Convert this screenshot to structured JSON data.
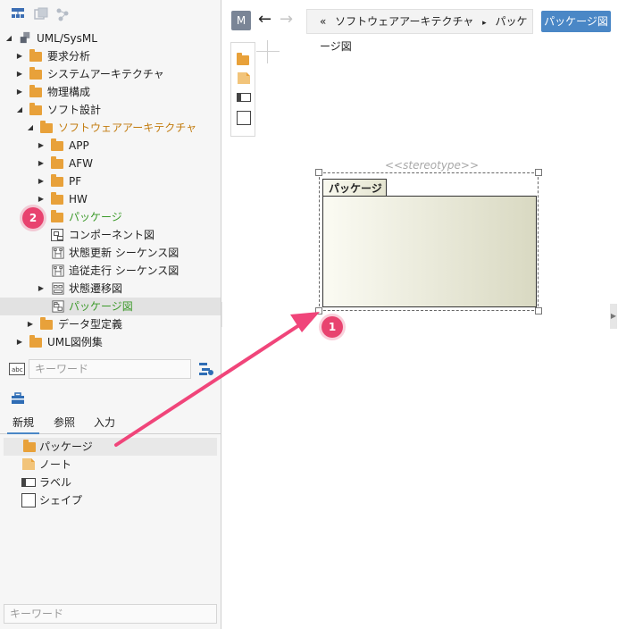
{
  "tree": {
    "items": [
      {
        "label": "UML/SysML"
      },
      {
        "label": "要求分析"
      },
      {
        "label": "システムアーキテクチャ"
      },
      {
        "label": "物理構成"
      },
      {
        "label": "ソフト設計"
      },
      {
        "label": "ソフトウェアアーキテクチャ"
      },
      {
        "label": "APP"
      },
      {
        "label": "AFW"
      },
      {
        "label": "PF"
      },
      {
        "label": "HW"
      },
      {
        "label": "パッケージ"
      },
      {
        "label": "コンポーネント図"
      },
      {
        "label": "状態更新 シーケンス図"
      },
      {
        "label": "追従走行 シーケンス図"
      },
      {
        "label": "状態遷移図"
      },
      {
        "label": "パッケージ図"
      },
      {
        "label": "データ型定義"
      },
      {
        "label": "UML図例集"
      }
    ]
  },
  "search": {
    "placeholder": "キーワード"
  },
  "palette": {
    "tabs": [
      {
        "label": "新規"
      },
      {
        "label": "参照"
      },
      {
        "label": "入力"
      }
    ],
    "items": [
      {
        "label": "パッケージ"
      },
      {
        "label": "ノート"
      },
      {
        "label": "ラベル"
      },
      {
        "label": "シェイプ"
      }
    ],
    "search_placeholder": "キーワード"
  },
  "badges": {
    "one": "1",
    "two": "2"
  },
  "editor": {
    "m_button": "M",
    "back_arrow": "←",
    "forward_arrow": "→",
    "crumb_prefix": "«",
    "crumb_parent": "ソフトウェアアーキテクチャ",
    "crumb_sep": "▸",
    "crumb_current": "パッケージ図",
    "diagram_button": "パッケージ図"
  },
  "package_element": {
    "stereotype": "<<stereotype>>",
    "name": "パッケージ"
  },
  "colors": {
    "accent": "#4a87c6",
    "folder": "#e8a13a",
    "badge": "#e8436f",
    "highlight_green": "#3c9a2a",
    "highlight_orange": "#c27b0e"
  }
}
